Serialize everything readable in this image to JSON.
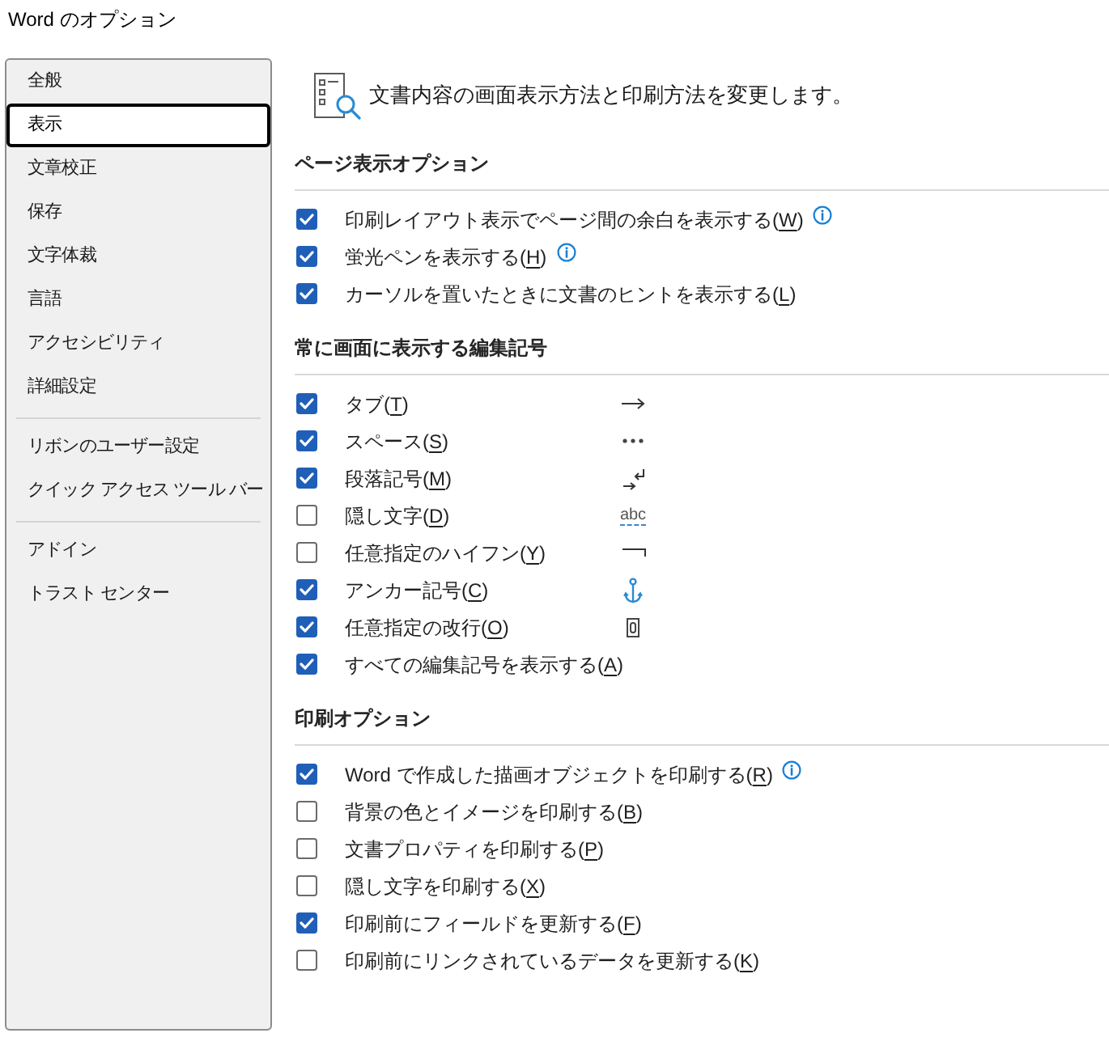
{
  "window": {
    "title": "Word のオプション"
  },
  "sidebar": {
    "groups": [
      {
        "items": [
          {
            "label": "全般",
            "selected": false
          },
          {
            "label": "表示",
            "selected": true
          },
          {
            "label": "文章校正",
            "selected": false
          },
          {
            "label": "保存",
            "selected": false
          },
          {
            "label": "文字体裁",
            "selected": false
          },
          {
            "label": "言語",
            "selected": false
          },
          {
            "label": "アクセシビリティ",
            "selected": false
          },
          {
            "label": "詳細設定",
            "selected": false
          }
        ]
      },
      {
        "items": [
          {
            "label": "リボンのユーザー設定",
            "selected": false
          },
          {
            "label": "クイック アクセス ツール バー",
            "selected": false
          }
        ]
      },
      {
        "items": [
          {
            "label": "アドイン",
            "selected": false
          },
          {
            "label": "トラスト センター",
            "selected": false
          }
        ]
      }
    ]
  },
  "header": {
    "text": "文書内容の画面表示方法と印刷方法を変更します。"
  },
  "sections": [
    {
      "title": "ページ表示オプション",
      "options": [
        {
          "label": "印刷レイアウト表示でページ間の余白を表示する(W)",
          "checked": true,
          "info": true
        },
        {
          "label": "蛍光ペンを表示する(H)",
          "checked": true,
          "info": true
        },
        {
          "label": "カーソルを置いたときに文書のヒントを表示する(L)",
          "checked": true
        }
      ]
    },
    {
      "title": "常に画面に表示する編集記号",
      "options": [
        {
          "label": "タブ(T)",
          "checked": true,
          "symbol": {
            "kind": "arrow"
          }
        },
        {
          "label": "スペース(S)",
          "checked": true,
          "symbol": {
            "kind": "dots"
          }
        },
        {
          "label": "段落記号(M)",
          "checked": true,
          "symbol": {
            "kind": "return"
          }
        },
        {
          "label": "隠し文字(D)",
          "checked": false,
          "symbol": {
            "kind": "sample",
            "text": "abc"
          }
        },
        {
          "label": "任意指定のハイフン(Y)",
          "checked": false,
          "symbol": {
            "kind": "hook"
          }
        },
        {
          "label": "アンカー記号(C)",
          "checked": true,
          "symbol": {
            "kind": "anchor"
          }
        },
        {
          "label": "任意指定の改行(O)",
          "checked": true,
          "symbol": {
            "kind": "box"
          }
        },
        {
          "label": "すべての編集記号を表示する(A)",
          "checked": true
        }
      ]
    },
    {
      "title": "印刷オプション",
      "options": [
        {
          "label": "Word で作成した描画オブジェクトを印刷する(R)",
          "checked": true,
          "info": true
        },
        {
          "label": "背景の色とイメージを印刷する(B)",
          "checked": false
        },
        {
          "label": "文書プロパティを印刷する(P)",
          "checked": false
        },
        {
          "label": "隠し文字を印刷する(X)",
          "checked": false
        },
        {
          "label": "印刷前にフィールドを更新する(F)",
          "checked": true
        },
        {
          "label": "印刷前にリンクされているデータを更新する(K)",
          "checked": false
        }
      ]
    }
  ]
}
